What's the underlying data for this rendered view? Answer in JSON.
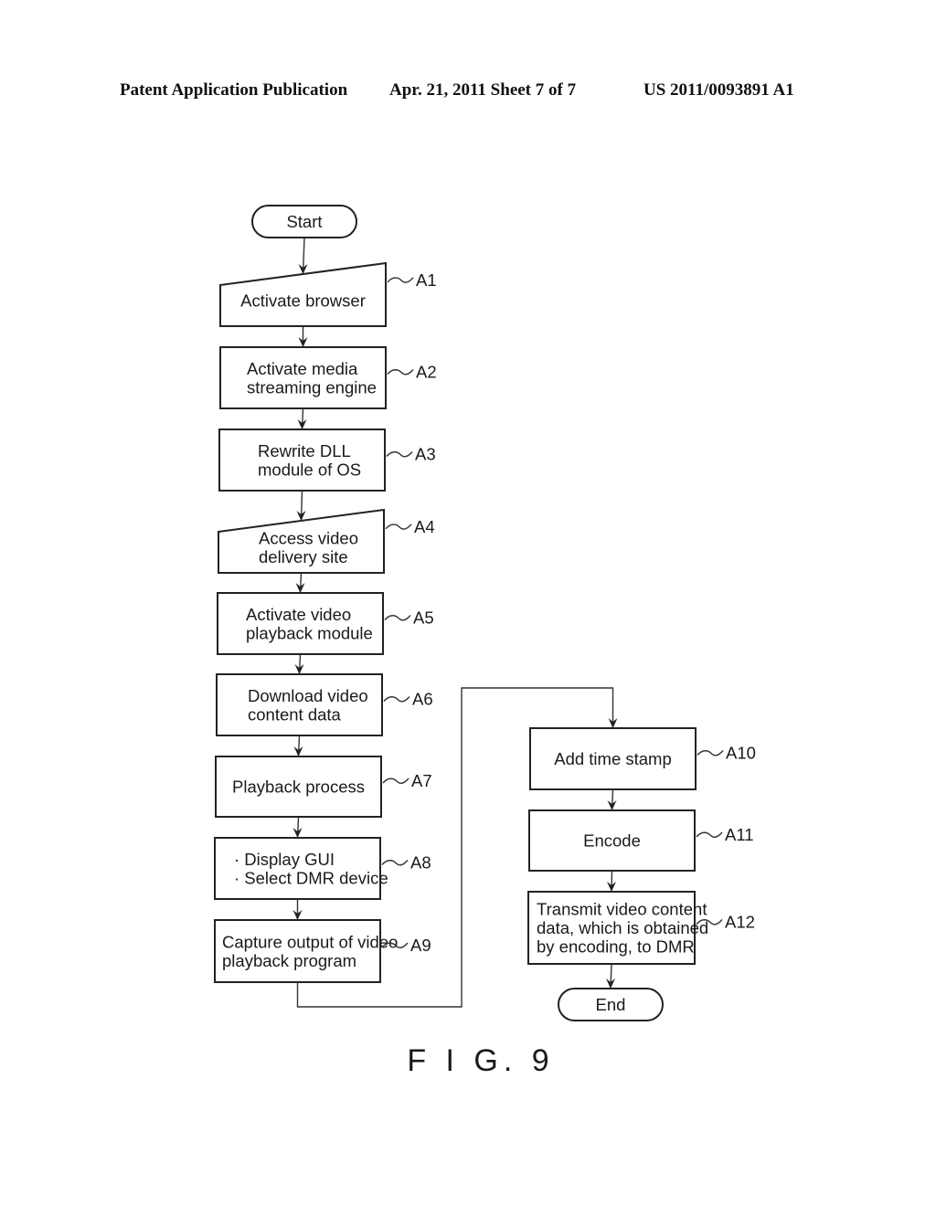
{
  "header": {
    "publication": "Patent Application Publication",
    "date_sheet": "Apr. 21, 2011  Sheet 7 of 7",
    "number": "US 2011/0093891 A1"
  },
  "diagram": {
    "figure_label": "F I G. 9",
    "terminals": {
      "start": "Start",
      "end": "End"
    },
    "steps": [
      {
        "id": "A1",
        "shape": "manual-input",
        "lines": [
          "Activate browser"
        ]
      },
      {
        "id": "A2",
        "shape": "process",
        "lines": [
          "Activate media",
          "streaming engine"
        ]
      },
      {
        "id": "A3",
        "shape": "process",
        "lines": [
          "Rewrite DLL",
          "module of OS"
        ]
      },
      {
        "id": "A4",
        "shape": "manual-input",
        "lines": [
          "Access video",
          "delivery site"
        ]
      },
      {
        "id": "A5",
        "shape": "process",
        "lines": [
          "Activate video",
          "playback module"
        ]
      },
      {
        "id": "A6",
        "shape": "process",
        "lines": [
          "Download video",
          "content data"
        ]
      },
      {
        "id": "A7",
        "shape": "process",
        "lines": [
          "Playback process"
        ]
      },
      {
        "id": "A8",
        "shape": "process",
        "lines": [
          "· Display GUI",
          "· Select DMR device"
        ]
      },
      {
        "id": "A9",
        "shape": "process",
        "lines": [
          "Capture output of video",
          "playback program"
        ]
      },
      {
        "id": "A10",
        "shape": "process",
        "lines": [
          "Add time stamp"
        ]
      },
      {
        "id": "A11",
        "shape": "process",
        "lines": [
          "Encode"
        ]
      },
      {
        "id": "A12",
        "shape": "process",
        "lines": [
          "Transmit video content",
          "data, which is obtained",
          "by encoding, to DMR"
        ]
      }
    ],
    "edges": [
      [
        "start",
        "A1"
      ],
      [
        "A1",
        "A2"
      ],
      [
        "A2",
        "A3"
      ],
      [
        "A3",
        "A4"
      ],
      [
        "A4",
        "A5"
      ],
      [
        "A5",
        "A6"
      ],
      [
        "A6",
        "A7"
      ],
      [
        "A7",
        "A8"
      ],
      [
        "A8",
        "A9"
      ],
      [
        "A9",
        "A10"
      ],
      [
        "A10",
        "A11"
      ],
      [
        "A11",
        "A12"
      ],
      [
        "A12",
        "end"
      ]
    ]
  }
}
